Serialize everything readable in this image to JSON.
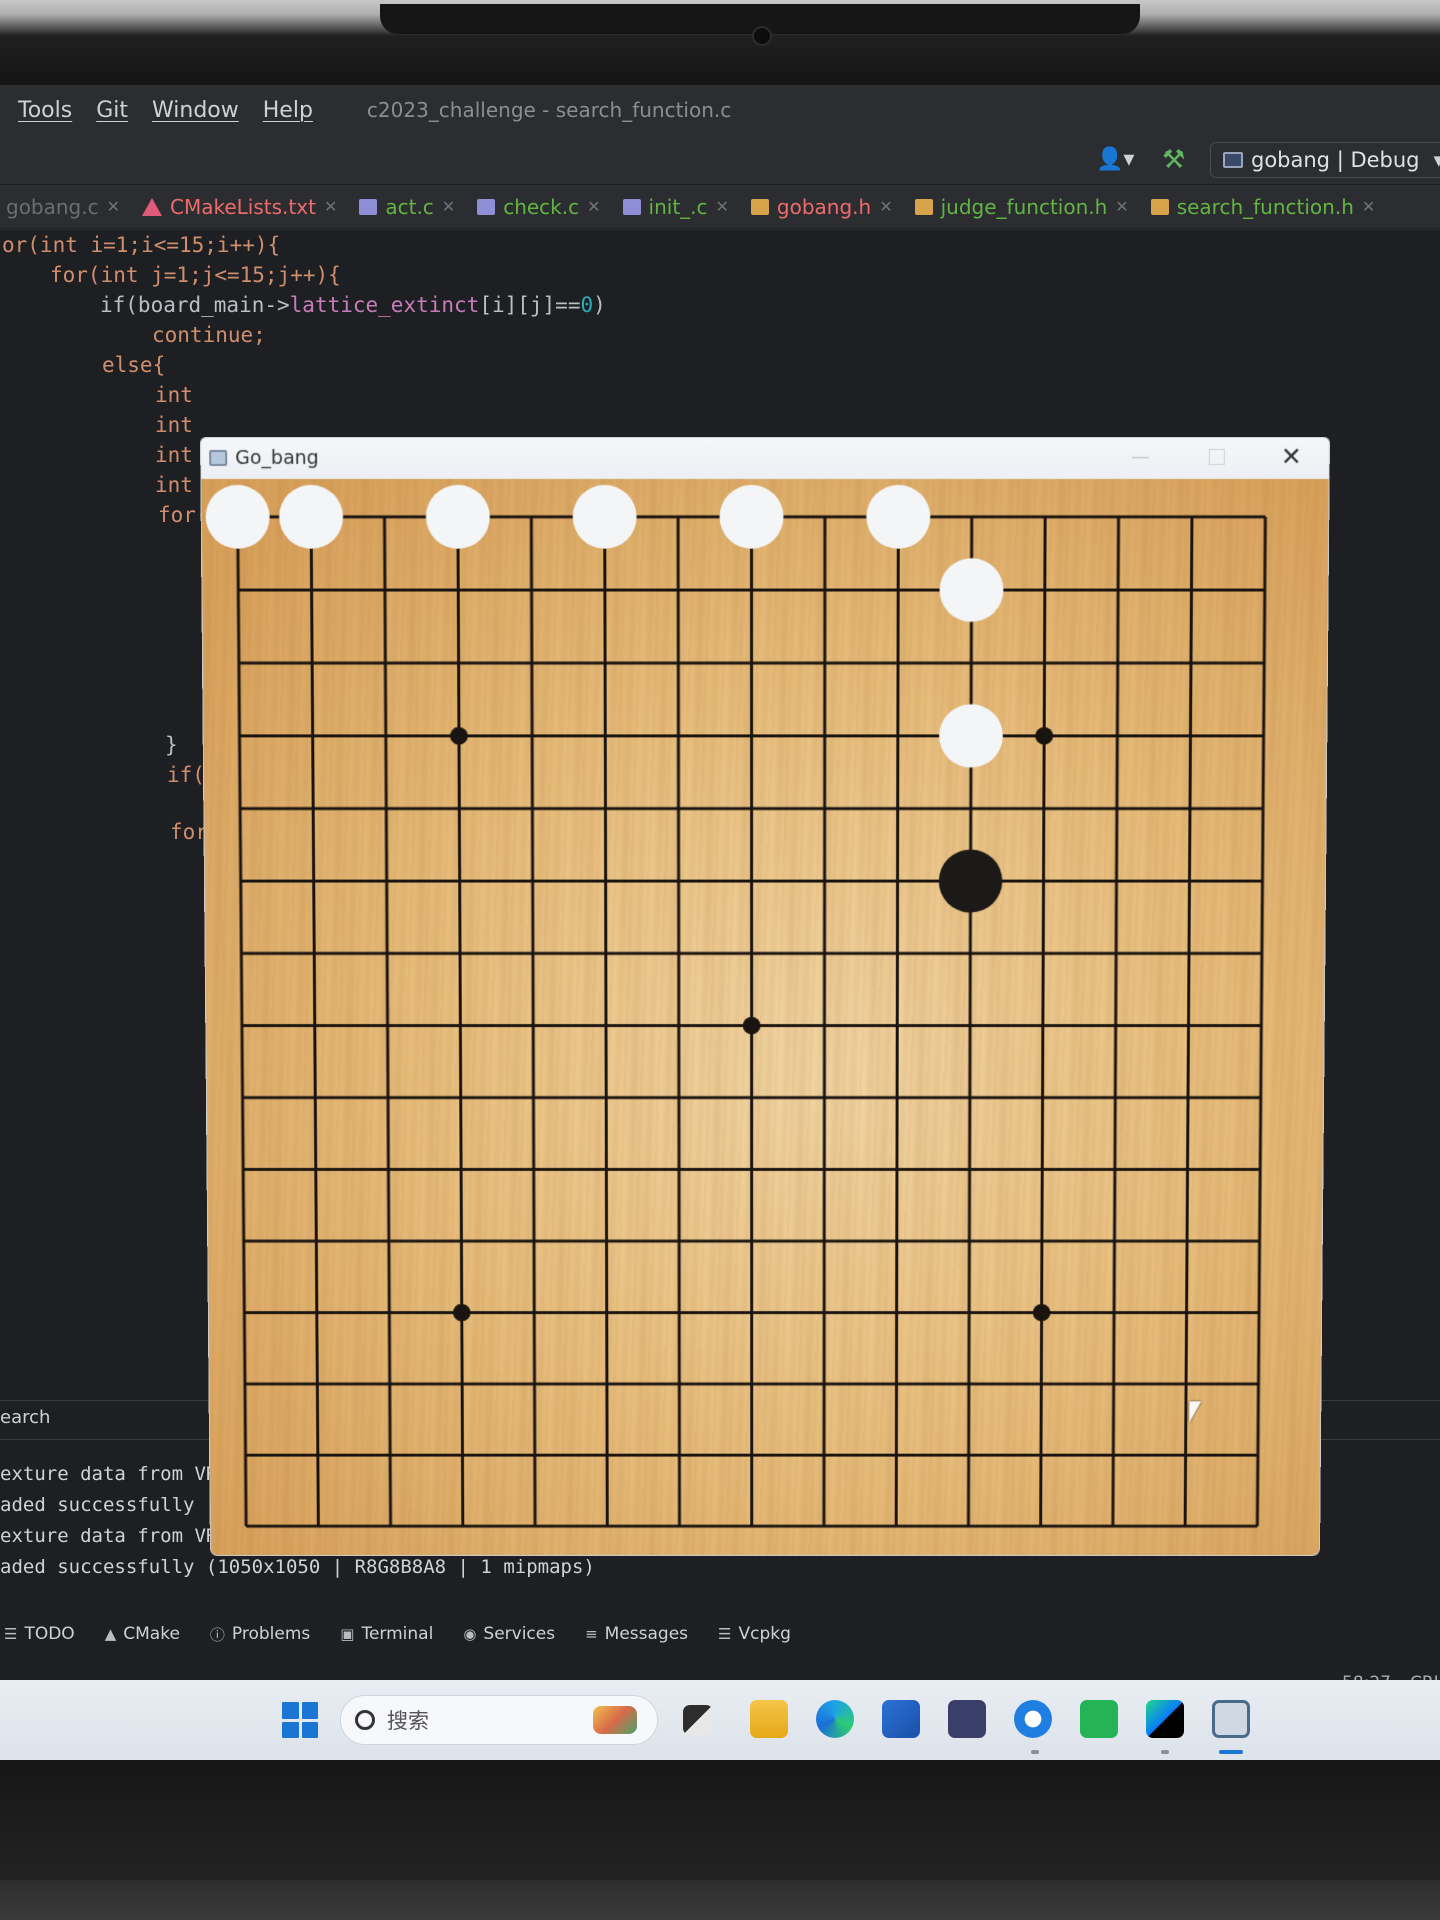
{
  "menubar": {
    "items": [
      "Tools",
      "Git",
      "Window",
      "Help"
    ],
    "title": "c2023_challenge - search_function.c"
  },
  "toolbar": {
    "run_config": "gobang | Debug",
    "user_icon": "user-icon",
    "build_icon": "hammer-icon"
  },
  "tabs": [
    {
      "label": "gobang.c",
      "kind": "c",
      "state": "dim"
    },
    {
      "label": "CMakeLists.txt",
      "kind": "cmake",
      "state": "red"
    },
    {
      "label": "act.c",
      "kind": "c",
      "state": "green"
    },
    {
      "label": "check.c",
      "kind": "c",
      "state": "green"
    },
    {
      "label": "init_.c",
      "kind": "c",
      "state": "green"
    },
    {
      "label": "gobang.h",
      "kind": "h",
      "state": "red"
    },
    {
      "label": "judge_function.h",
      "kind": "h",
      "state": "green"
    },
    {
      "label": "search_function.h",
      "kind": "h",
      "state": "green"
    }
  ],
  "code": {
    "l1": "or(int i=1;i<=15;i++){",
    "l2": "for(int j=1;j<=15;j++){",
    "l3a": "if(board_main->",
    "l3b": "lattice_extinct",
    "l3c": "[i][j]==",
    "l3d": "0",
    "l3e": ")",
    "l4": "continue;",
    "l5": "else{",
    "l6": "int",
    "l7": "int",
    "l8": "int",
    "l9": "int",
    "l10": "for(",
    "l11": "}",
    "l12": "if(",
    "l13": "for("
  },
  "bottom_panel": {
    "search_label": "earch",
    "console_lines": [
      "exture data from VRA",
      "aded successfully (1050x1050 | R8G8B8A8 | 1 mipmaps)",
      "exture data from VRAM (GPU)",
      "aded successfully (1050x1050 | R8G8B8A8 | 1 mipmaps)"
    ],
    "tool_windows": [
      {
        "label": "TODO",
        "icon": "list-icon"
      },
      {
        "label": "CMake",
        "icon": "cmake-icon"
      },
      {
        "label": "Problems",
        "icon": "info-icon"
      },
      {
        "label": "Terminal",
        "icon": "terminal-icon"
      },
      {
        "label": "Services",
        "icon": "services-icon"
      },
      {
        "label": "Messages",
        "icon": "messages-icon"
      },
      {
        "label": "Vcpkg",
        "icon": "vcpkg-icon"
      }
    ],
    "status_pos": "58:27",
    "status_crlf": "CRL"
  },
  "taskbar": {
    "search_placeholder": "搜索",
    "apps": [
      "task-view-icon",
      "file-explorer-icon",
      "edge-icon",
      "store-icon",
      "app-cube-icon",
      "ie-icon",
      "wechat-work-icon",
      "clion-icon",
      "gobang-app-icon"
    ]
  },
  "game_window": {
    "title": "Go_bang",
    "board_size": 15,
    "star_points": [
      [
        4,
        4
      ],
      [
        4,
        12
      ],
      [
        8,
        8
      ],
      [
        12,
        4
      ],
      [
        12,
        12
      ]
    ],
    "white_stones": [
      [
        1,
        1
      ],
      [
        1,
        2
      ],
      [
        1,
        4
      ],
      [
        1,
        6
      ],
      [
        1,
        8
      ],
      [
        1,
        10
      ],
      [
        2,
        11
      ],
      [
        4,
        11
      ]
    ],
    "black_stones": [
      [
        6,
        11
      ]
    ],
    "colors": {
      "white_stone": "#f4f5f7",
      "black_stone": "#1c1a18",
      "line": "#1a1410"
    }
  }
}
